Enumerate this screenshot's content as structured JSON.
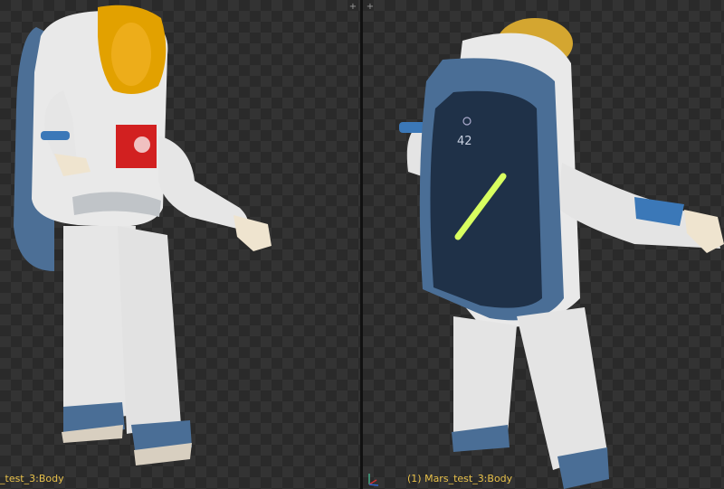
{
  "viewports": {
    "left": {
      "object_label": "_test_3:Body",
      "corner_icon": "plus-icon"
    },
    "right": {
      "object_label": "(1) Mars_test_3:Body",
      "corner_icon": "plus-icon",
      "backpack_display": "42"
    }
  },
  "colors": {
    "suit_white": "#e8e8e8",
    "backpack_blue": "#4a6a90",
    "visor_gold": "#e0a000",
    "label_yellow": "#e8c14a",
    "glow_green": "#d8ff60"
  }
}
